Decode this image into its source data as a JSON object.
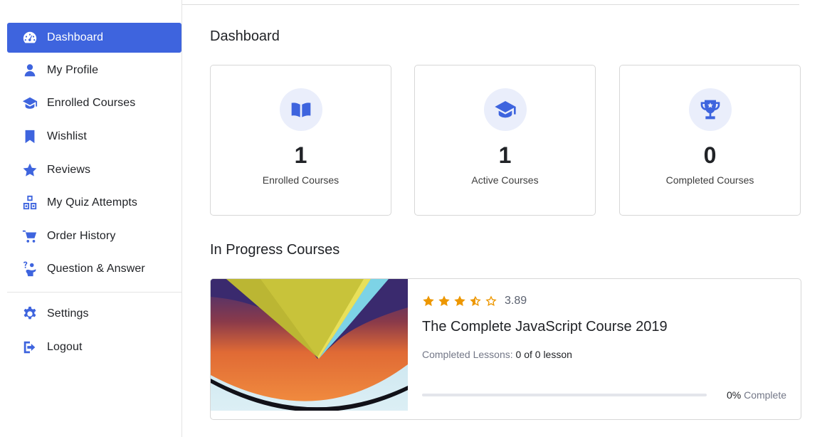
{
  "sidebar": {
    "items": [
      {
        "label": "Dashboard",
        "icon": "dashboard-gauge-icon"
      },
      {
        "label": "My Profile",
        "icon": "user-icon"
      },
      {
        "label": "Enrolled Courses",
        "icon": "graduation-cap-icon"
      },
      {
        "label": "Wishlist",
        "icon": "bookmark-icon"
      },
      {
        "label": "Reviews",
        "icon": "star-icon"
      },
      {
        "label": "My Quiz Attempts",
        "icon": "quiz-blocks-icon"
      },
      {
        "label": "Order History",
        "icon": "cart-icon"
      },
      {
        "label": "Question & Answer",
        "icon": "question-person-icon"
      }
    ],
    "bottom_items": [
      {
        "label": "Settings",
        "icon": "gear-icon"
      },
      {
        "label": "Logout",
        "icon": "logout-icon"
      }
    ],
    "active": "Dashboard"
  },
  "main": {
    "title": "Dashboard",
    "stats": [
      {
        "value": "1",
        "label": "Enrolled Courses",
        "icon": "book-open-icon"
      },
      {
        "value": "1",
        "label": "Active Courses",
        "icon": "graduation-cap-icon"
      },
      {
        "value": "0",
        "label": "Completed Courses",
        "icon": "trophy-icon"
      }
    ],
    "in_progress_title": "In Progress Courses",
    "course": {
      "rating": "3.89",
      "rating_value": 3.89,
      "title": "The Complete JavaScript Course 2019",
      "lessons_label": "Completed Lessons:",
      "lessons_value": "0 of 0 lesson",
      "progress_percent": "0%",
      "progress_suffix": "Complete",
      "progress_fraction": 0
    }
  },
  "colors": {
    "accent": "#3e64de",
    "icon_bg": "#eaeefb",
    "star": "#ed9700"
  }
}
